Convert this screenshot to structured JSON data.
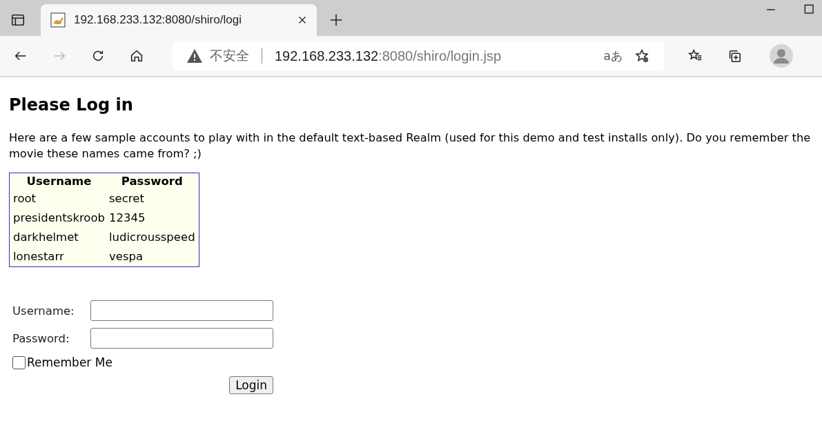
{
  "browser": {
    "tab": {
      "title": "192.168.233.132:8080/shiro/logi",
      "selected": true
    },
    "address": {
      "security": "不安全",
      "host": "192.168.233.132",
      "path": ":8080/shiro/login.jsp"
    },
    "translate_label": "aあ"
  },
  "page": {
    "heading": "Please Log in",
    "intro": "Here are a few sample accounts to play with in the default text-based Realm (used for this demo and test installs only). Do you remember the movie these names came from? ;)",
    "accounts": {
      "columns": [
        "Username",
        "Password"
      ],
      "rows": [
        [
          "root",
          "secret"
        ],
        [
          "presidentskroob",
          "12345"
        ],
        [
          "darkhelmet",
          "ludicrousspeed"
        ],
        [
          "lonestarr",
          "vespa"
        ]
      ]
    },
    "form": {
      "username_label": "Username:",
      "password_label": "Password:",
      "remember": {
        "label": "Remember Me",
        "checked": false
      },
      "submit": "Login"
    }
  }
}
